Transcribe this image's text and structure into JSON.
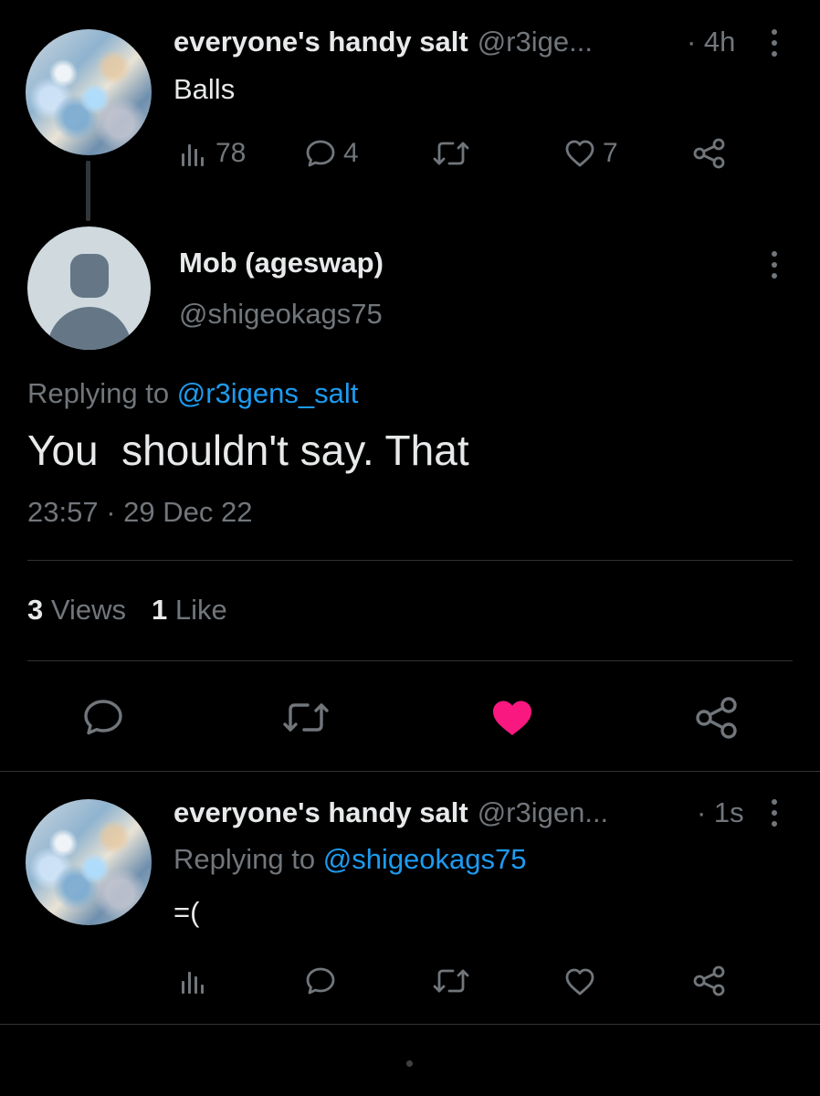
{
  "tweet1": {
    "display_name": "everyone's handy salt",
    "handle": "@r3ige...",
    "time": "· 4h",
    "text": "Balls",
    "views": "78",
    "replies": "4",
    "likes": "7"
  },
  "main": {
    "display_name": "Mob (ageswap)",
    "handle": "@shigeokags75",
    "replying_label": "Replying to",
    "replying_handle": "@r3igens_salt",
    "text": "You  shouldn't say. That",
    "timestamp": "23:57 · 29 Dec 22",
    "views_count": "3",
    "views_label": "Views",
    "likes_count": "1",
    "likes_label": "Like"
  },
  "tweet2": {
    "display_name": "everyone's handy salt",
    "handle": "@r3igen...",
    "time": "· 1s",
    "replying_label": "Replying to",
    "replying_handle": "@shigeokags75",
    "text": "=("
  },
  "colors": {
    "background": "#000000",
    "text": "#e7e9ea",
    "muted": "#71767b",
    "link": "#1d9bf0",
    "like_active": "#f91880",
    "divider": "#2f3336"
  },
  "icons": [
    "views-icon",
    "reply-icon",
    "retweet-icon",
    "like-icon",
    "share-icon",
    "more-icon"
  ]
}
